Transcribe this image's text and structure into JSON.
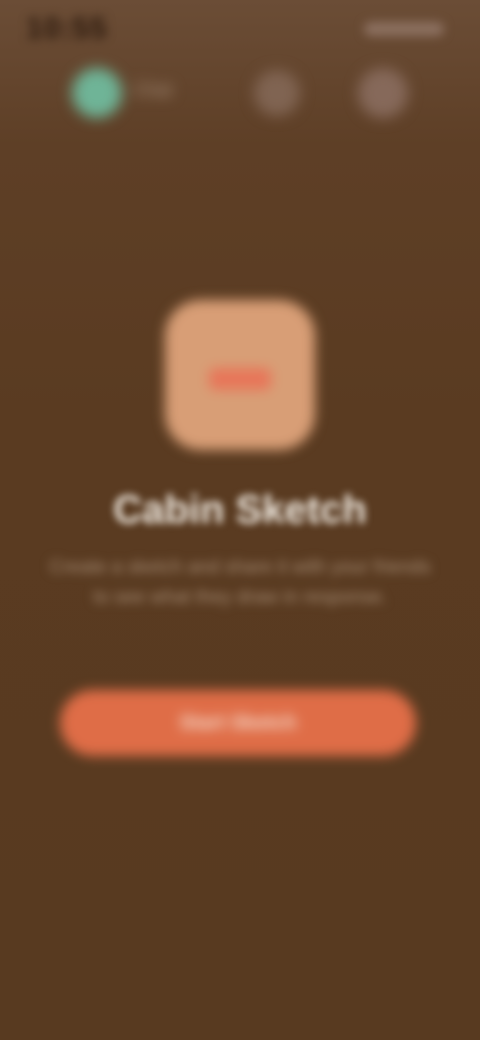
{
  "status_bar": {
    "time": "10:55"
  },
  "nav": {
    "avatar_icon": "avatar-icon",
    "label": "Chat",
    "action_1_icon": "call-icon",
    "action_2_icon": "menu-icon"
  },
  "app": {
    "icon": "app-icon",
    "title": "Cabin Sketch",
    "description": "Create a sketch and share it with your friends to see what they draw in response.",
    "button_label": "Start Sketch"
  },
  "colors": {
    "background": "#5a3b21",
    "accent": "#df6d47",
    "icon_bg": "#d89e76",
    "avatar": "#6fb497"
  }
}
